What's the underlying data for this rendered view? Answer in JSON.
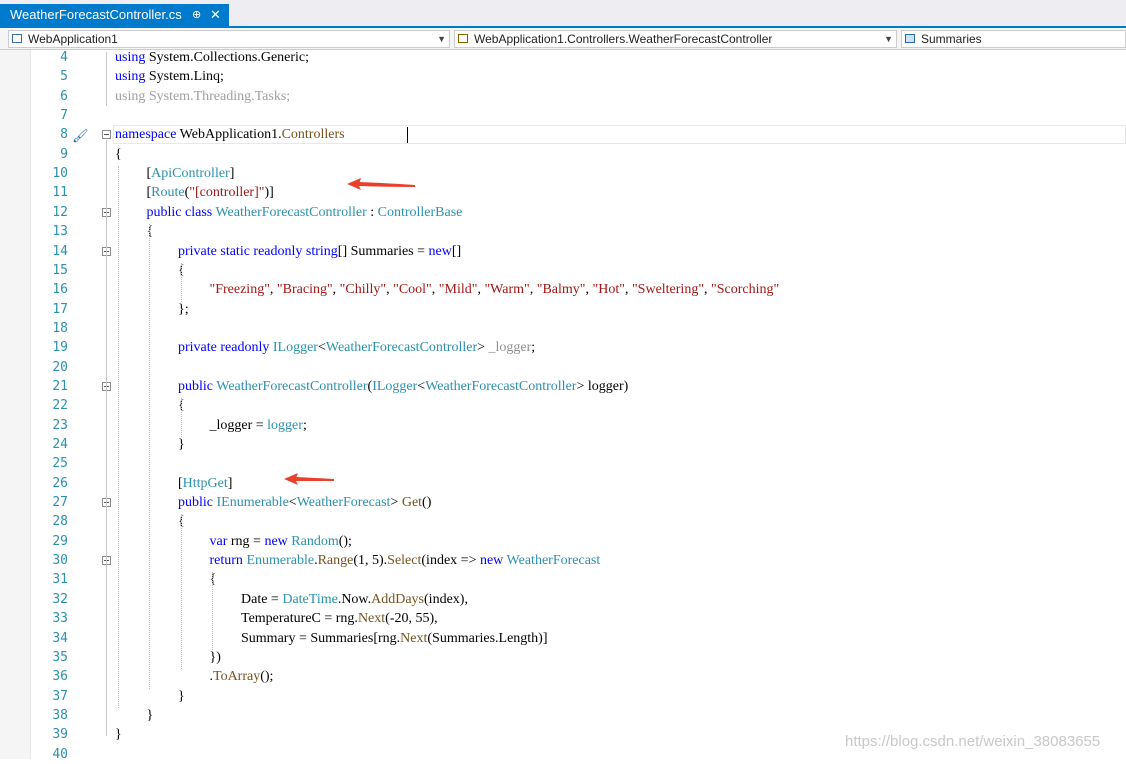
{
  "tab": {
    "title": "WeatherForecastController.cs",
    "pin_glyph": "⊕",
    "close_glyph": "✕"
  },
  "nav": {
    "project": "WebApplication1",
    "class_path": "WebApplication1.Controllers.WeatherForecastController",
    "member": "Summaries"
  },
  "line_numbers": [
    "4",
    "5",
    "6",
    "7",
    "8",
    "9",
    "10",
    "11",
    "12",
    "13",
    "14",
    "15",
    "16",
    "17",
    "18",
    "19",
    "20",
    "21",
    "22",
    "23",
    "24",
    "25",
    "26",
    "27",
    "28",
    "29",
    "30",
    "31",
    "32",
    "33",
    "34",
    "35",
    "36",
    "37",
    "38",
    "39",
    "40"
  ],
  "code": {
    "l4": [
      "using",
      " System.Collections.Generic;"
    ],
    "l5": [
      "using",
      " System.Linq;"
    ],
    "l6": [
      "using System.Threading.Tasks;"
    ],
    "l8": [
      "namespace",
      " WebApplication1.",
      "Controllers"
    ],
    "l9": [
      "{"
    ],
    "l10": [
      "[",
      "ApiController",
      "]"
    ],
    "l11": [
      "[",
      "Route",
      "(",
      "\"[controller]\"",
      ")]"
    ],
    "l12": [
      "public",
      " ",
      "class",
      " ",
      "WeatherForecastController",
      " : ",
      "ControllerBase"
    ],
    "l13": [
      "{"
    ],
    "l14": [
      "private",
      " ",
      "static",
      " ",
      "readonly",
      " ",
      "string",
      "[] Summaries = ",
      "new",
      "[]"
    ],
    "l15": [
      "{"
    ],
    "l16": [
      "\"Freezing\"",
      ", ",
      "\"Bracing\"",
      ", ",
      "\"Chilly\"",
      ", ",
      "\"Cool\"",
      ", ",
      "\"Mild\"",
      ", ",
      "\"Warm\"",
      ", ",
      "\"Balmy\"",
      ", ",
      "\"Hot\"",
      ", ",
      "\"Sweltering\"",
      ", ",
      "\"Scorching\""
    ],
    "l17": [
      "};"
    ],
    "l19": [
      "private",
      " ",
      "readonly",
      " ",
      "ILogger",
      "<",
      "WeatherForecastController",
      "> ",
      "_logger",
      ";"
    ],
    "l21": [
      "public",
      " ",
      "WeatherForecastController",
      "(",
      "ILogger",
      "<",
      "WeatherForecastController",
      "> logger)"
    ],
    "l22": [
      "{"
    ],
    "l23": [
      "_logger = ",
      "logger",
      ";"
    ],
    "l24": [
      "}"
    ],
    "l26": [
      "[",
      "HttpGet",
      "]"
    ],
    "l27": [
      "public",
      " ",
      "IEnumerable",
      "<",
      "WeatherForecast",
      "> ",
      "Get",
      "()"
    ],
    "l28": [
      "{"
    ],
    "l29": [
      "var",
      " rng = ",
      "new",
      " ",
      "Random",
      "();"
    ],
    "l30": [
      "return",
      " ",
      "Enumerable",
      ".",
      "Range",
      "(1, 5).",
      "Select",
      "(index => ",
      "new",
      " ",
      "WeatherForecast"
    ],
    "l31": [
      "{"
    ],
    "l32": [
      "Date = ",
      "DateTime",
      ".Now.",
      "AddDays",
      "(index),"
    ],
    "l33": [
      "TemperatureC = rng.",
      "Next",
      "(-20, 55),"
    ],
    "l34": [
      "Summary = Summaries[rng.",
      "Next",
      "(Summaries.Length)]"
    ],
    "l35": [
      "})"
    ],
    "l36": [
      ".",
      "ToArray",
      "();"
    ],
    "l37": [
      "}"
    ],
    "l38": [
      "}"
    ],
    "l39": [
      "}"
    ]
  },
  "watermark": "https://blog.csdn.net/weixin_38083655",
  "colors": {
    "keyword": "#0000ff",
    "type": "#2b91af",
    "string": "#a31515",
    "method": "#74531f",
    "accent": "#007acc",
    "arrow": "#e8402a"
  }
}
